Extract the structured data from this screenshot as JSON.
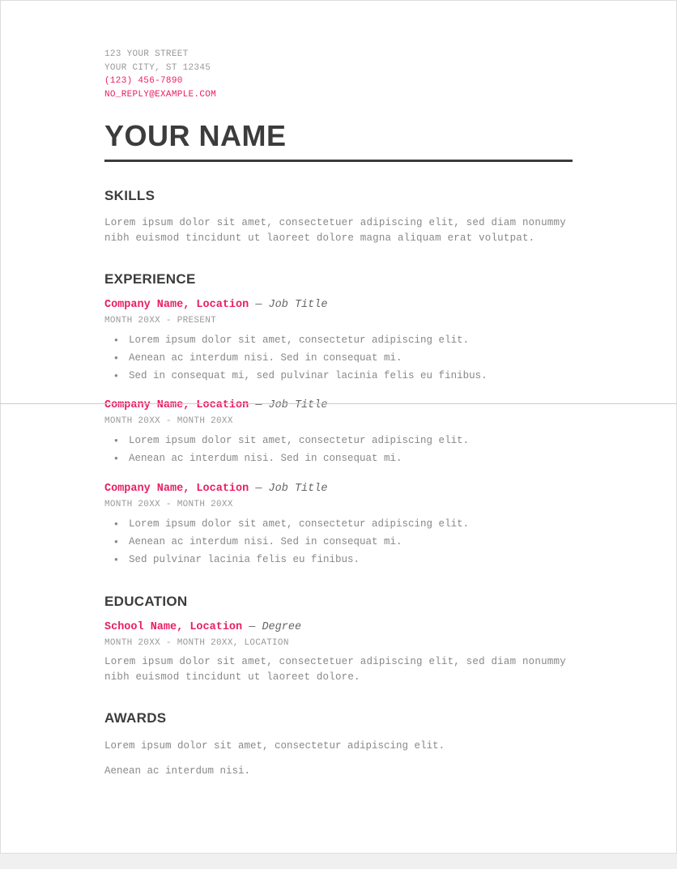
{
  "contact": {
    "street": "123 YOUR STREET",
    "city": "YOUR CITY, ST 12345",
    "phone": "(123) 456-7890",
    "email": "NO_REPLY@EXAMPLE.COM"
  },
  "name": "YOUR NAME",
  "sections": {
    "skills": {
      "title": "SKILLS",
      "text": "Lorem ipsum dolor sit amet, consectetuer adipiscing elit, sed diam nonummy nibh euismod tincidunt ut laoreet dolore magna aliquam erat volutpat."
    },
    "experience": {
      "title": "EXPERIENCE",
      "items": [
        {
          "company": "Company Name, Location",
          "sep": " — ",
          "role": "Job Title",
          "date": "MONTH 20XX - PRESENT",
          "bullets": [
            "Lorem ipsum dolor sit amet, consectetur adipiscing elit.",
            "Aenean ac interdum nisi. Sed in consequat mi.",
            "Sed in consequat mi, sed pulvinar lacinia felis eu finibus."
          ]
        },
        {
          "company": "Company Name, Location",
          "sep": " — ",
          "role": "Job Title",
          "date": "MONTH 20XX - MONTH 20XX",
          "bullets": [
            "Lorem ipsum dolor sit amet, consectetur adipiscing elit.",
            "Aenean ac interdum nisi. Sed in consequat mi."
          ]
        },
        {
          "company": "Company Name, Location",
          "sep": " — ",
          "role": "Job Title",
          "date": "MONTH 20XX - MONTH 20XX",
          "bullets": [
            "Lorem ipsum dolor sit amet, consectetur adipiscing elit.",
            "Aenean ac interdum nisi. Sed in consequat mi.",
            "Sed pulvinar lacinia felis eu finibus."
          ]
        }
      ]
    },
    "education": {
      "title": "EDUCATION",
      "items": [
        {
          "school": "School Name, Location",
          "sep": " — ",
          "degree": "Degree",
          "date": "MONTH 20XX - MONTH 20XX, LOCATION",
          "text": "Lorem ipsum dolor sit amet, consectetuer adipiscing elit, sed diam nonummy nibh euismod tincidunt ut laoreet dolore."
        }
      ]
    },
    "awards": {
      "title": "AWARDS",
      "lines": [
        "Lorem ipsum dolor sit amet, consectetur adipiscing elit.",
        "Aenean ac interdum nisi."
      ]
    }
  }
}
